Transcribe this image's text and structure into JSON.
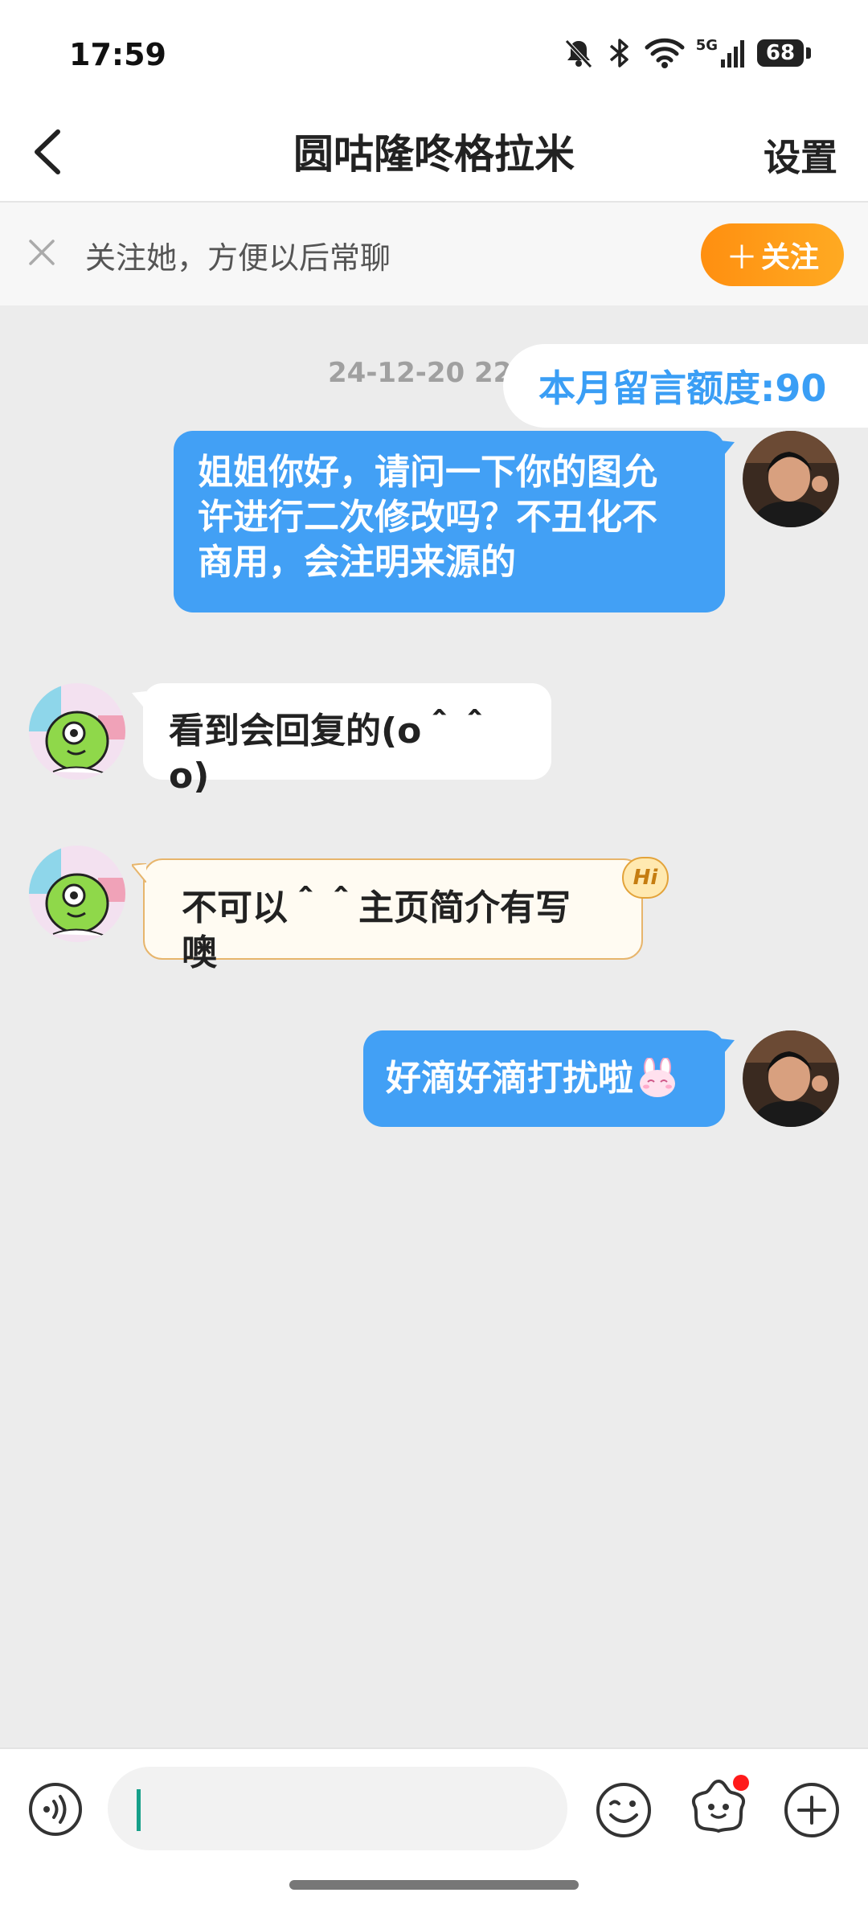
{
  "status_bar": {
    "time": "17:59",
    "network_label": "5G",
    "battery": "68"
  },
  "header": {
    "title": "圆咕隆咚格拉米",
    "settings_label": "设置"
  },
  "follow_banner": {
    "text": "关注她，方便以后常聊",
    "button_label": "关注"
  },
  "chat": {
    "timestamp": "24-12-20 22:3",
    "quota_label": "本月留言额度:90",
    "messages": [
      {
        "side": "out",
        "lines": [
          "姐姐你好，请问一下你的图允",
          "许进行二次修改吗？不丑化不",
          "商用，会注明来源的"
        ]
      },
      {
        "side": "in",
        "text": "看到会回复的(o＾＾o)"
      },
      {
        "side": "in",
        "text": "不可以＾＾主页简介有写噢",
        "badge": "Hi"
      },
      {
        "side": "out",
        "text": "好滴好滴打扰啦"
      }
    ]
  },
  "input_bar": {
    "placeholder": "",
    "value": ""
  },
  "colors": {
    "accent_blue": "#42a0f5",
    "follow_orange": "#ff9a18",
    "chat_background": "#ececec",
    "notification_dot": "#ff1a1a"
  }
}
